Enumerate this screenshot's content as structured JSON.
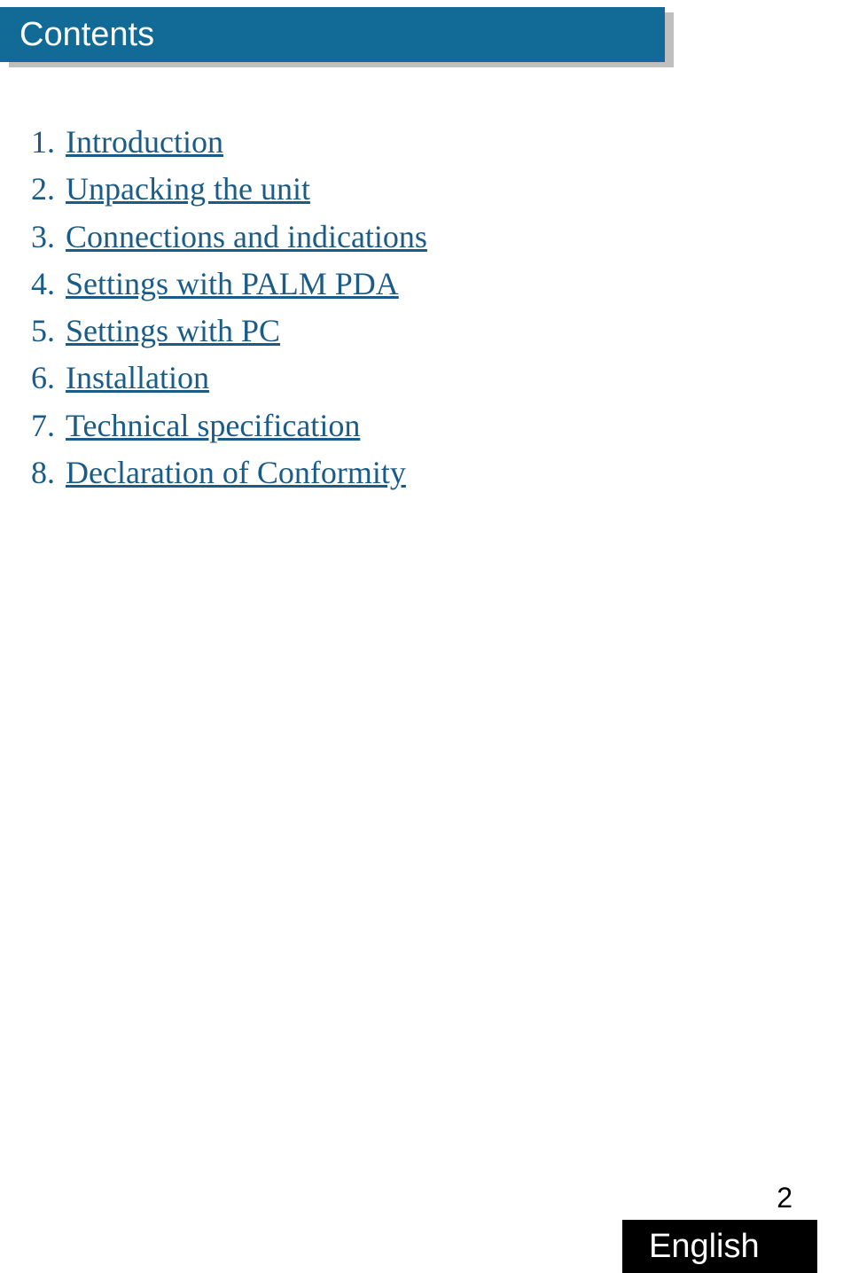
{
  "header": {
    "title": "Contents"
  },
  "toc": {
    "items": [
      {
        "num": "1.",
        "label": "Introduction"
      },
      {
        "num": "2.",
        "label": "Unpacking the unit"
      },
      {
        "num": "3.",
        "label": "Connections and indications"
      },
      {
        "num": "4.",
        "label": "Settings with PALM PDA"
      },
      {
        "num": "5.",
        "label": "Settings with PC"
      },
      {
        "num": "6.",
        "label": "Installation"
      },
      {
        "num": "7.",
        "label": "Technical specification"
      },
      {
        "num": "8.",
        "label": "Declaration of Conformity"
      }
    ]
  },
  "footer": {
    "page_number": "2",
    "language": "English"
  }
}
